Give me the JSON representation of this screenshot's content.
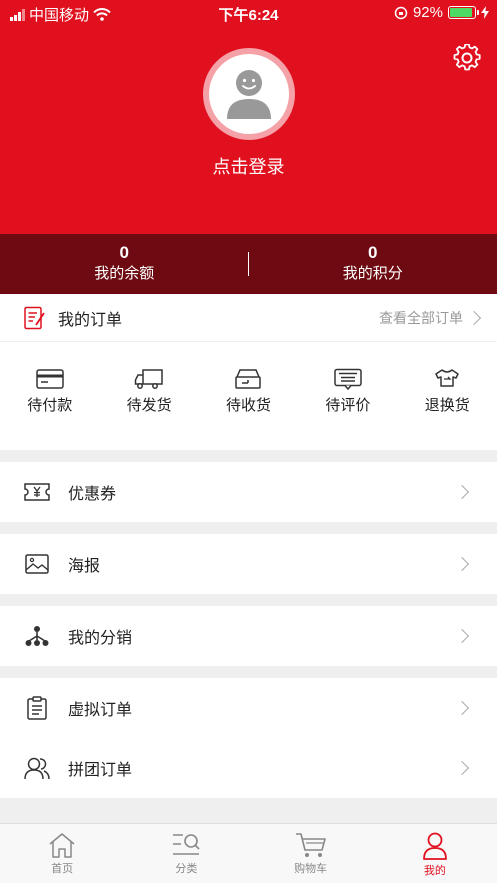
{
  "status_bar": {
    "carrier": "中国移动",
    "time": "下午6:24",
    "battery": "92%"
  },
  "header": {
    "login_text": "点击登录"
  },
  "stats": [
    {
      "value": "0",
      "label": "我的余额"
    },
    {
      "value": "0",
      "label": "我的积分"
    }
  ],
  "orders": {
    "title": "我的订单",
    "view_all": "查看全部订单",
    "items": [
      {
        "label": "待付款",
        "icon": "wallet-card-icon"
      },
      {
        "label": "待发货",
        "icon": "truck-icon"
      },
      {
        "label": "待收货",
        "icon": "package-icon"
      },
      {
        "label": "待评价",
        "icon": "comment-icon"
      },
      {
        "label": "退换货",
        "icon": "return-shirt-icon"
      }
    ]
  },
  "menu": [
    {
      "label": "优惠券",
      "icon": "coupon-icon"
    },
    {
      "label": "海报",
      "icon": "image-icon"
    },
    {
      "label": "我的分销",
      "icon": "distribution-icon"
    },
    {
      "label": "虚拟订单",
      "icon": "clipboard-icon"
    },
    {
      "label": "拼团订单",
      "icon": "group-user-icon"
    }
  ],
  "tabbar": [
    {
      "label": "首页",
      "icon": "home-icon"
    },
    {
      "label": "分类",
      "icon": "category-search-icon"
    },
    {
      "label": "购物车",
      "icon": "cart-icon"
    },
    {
      "label": "我的",
      "icon": "user-icon",
      "active": true
    }
  ],
  "colors": {
    "brand": "#e0101f",
    "dark_band": "#6e0b12"
  }
}
